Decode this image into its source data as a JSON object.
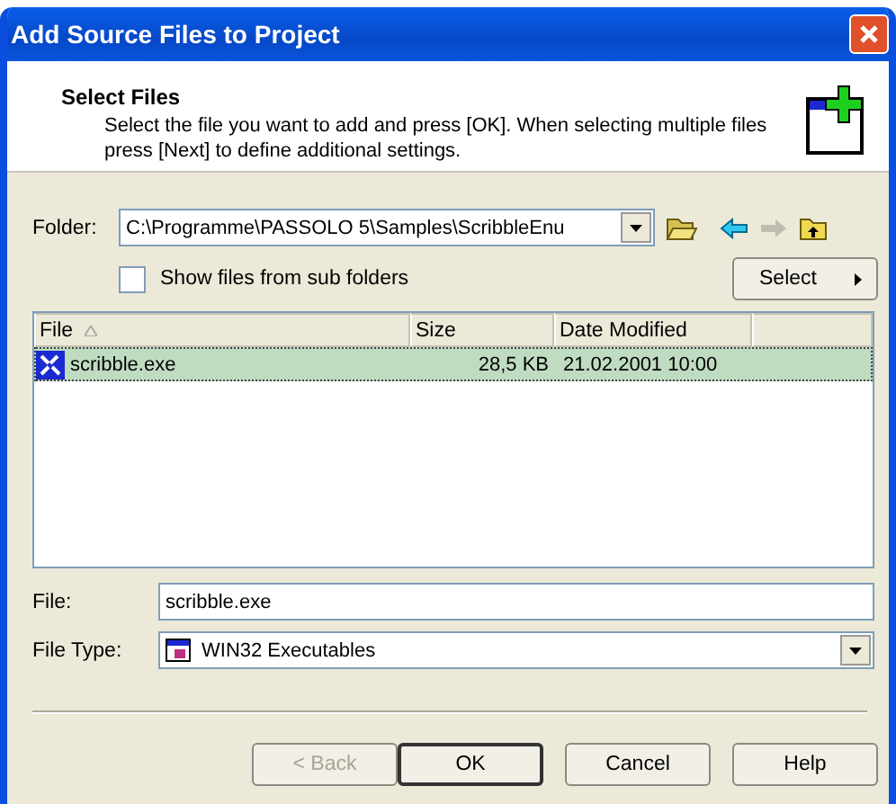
{
  "window": {
    "title": "Add Source Files to Project"
  },
  "header": {
    "title": "Select Files",
    "description": "Select the file you want to add and press [OK]. When selecting multiple files press [Next] to define additional settings."
  },
  "folder": {
    "label": "Folder:",
    "value": "C:\\Programme\\PASSOLO 5\\Samples\\ScribbleEnu"
  },
  "subfolders": {
    "label": "Show files from sub folders",
    "checked": false
  },
  "select_button": {
    "label": "Select"
  },
  "table": {
    "columns": [
      "File",
      "Size",
      "Date Modified"
    ],
    "rows": [
      {
        "file": "scribble.exe",
        "size": "28,5 KB",
        "modified": "21.02.2001 10:00",
        "selected": true
      }
    ]
  },
  "file": {
    "label": "File:",
    "value": "scribble.exe"
  },
  "file_type": {
    "label": "File Type:",
    "value": "WIN32 Executables"
  },
  "buttons": [
    {
      "label": "< Back",
      "disabled": true,
      "default": false
    },
    {
      "label": "OK",
      "disabled": false,
      "default": true
    },
    {
      "label": "Cancel",
      "disabled": false,
      "default": false
    },
    {
      "label": "Help",
      "disabled": false,
      "default": false
    }
  ]
}
